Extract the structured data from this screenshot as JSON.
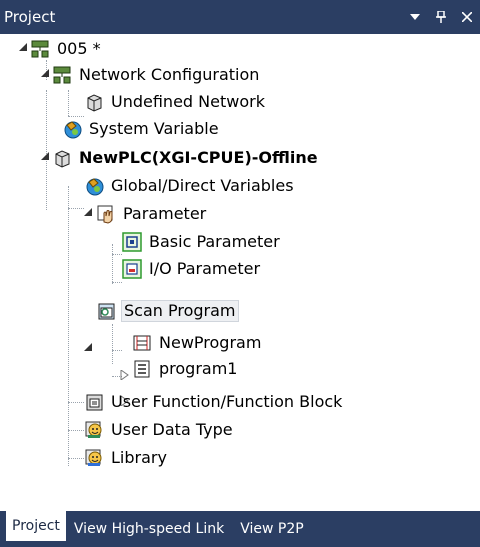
{
  "panel": {
    "title": "Project"
  },
  "tree": {
    "root": "005 *",
    "network_configuration": "Network Configuration",
    "undefined_network": "Undefined Network",
    "system_variable": "System Variable",
    "plc": "NewPLC(XGI-CPUE)-Offline",
    "global_direct_variables": "Global/Direct Variables",
    "parameter": "Parameter",
    "basic_parameter": "Basic Parameter",
    "io_parameter": "I/O Parameter",
    "scan_program": "Scan Program",
    "new_program": "NewProgram",
    "program1": "program1",
    "user_function_block": "User Function/Function Block",
    "user_data_type": "User Data Type",
    "library": "Library"
  },
  "tabs": [
    {
      "label": "Project",
      "active": true
    },
    {
      "label": "View High-speed Link",
      "active": false
    },
    {
      "label": "View P2P",
      "active": false
    }
  ],
  "colors": {
    "header": "#2b3e63",
    "selection": "#eef0f3"
  }
}
